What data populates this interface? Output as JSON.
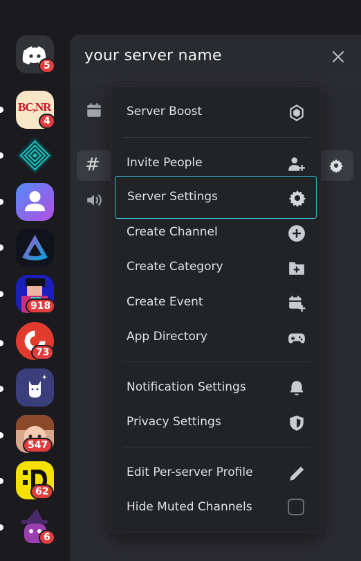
{
  "rail": {
    "servers": [
      {
        "name": "discord-home",
        "badge": "5"
      },
      {
        "name": "bcnr",
        "badge": "4",
        "text": "BC,NR"
      },
      {
        "name": "diamond-server",
        "badge": ""
      },
      {
        "name": "user-server",
        "badge": ""
      },
      {
        "name": "jellyfin-server",
        "badge": ""
      },
      {
        "name": "pixel-server",
        "badge": "918"
      },
      {
        "name": "red-server",
        "badge": "73"
      },
      {
        "name": "cat-server",
        "badge": ""
      },
      {
        "name": "anime-server",
        "badge": "547"
      },
      {
        "name": "yellow-server",
        "badge": "62"
      },
      {
        "name": "witch-server",
        "badge": "6"
      }
    ]
  },
  "panel": {
    "title": "your server name"
  },
  "menu": {
    "server_boost": "Server Boost",
    "invite_people": "Invite People",
    "server_settings": "Server Settings",
    "create_channel": "Create Channel",
    "create_category": "Create Category",
    "create_event": "Create Event",
    "app_directory": "App Directory",
    "notification_settings": "Notification Settings",
    "privacy_settings": "Privacy Settings",
    "edit_profile": "Edit Per-server Profile",
    "hide_muted": "Hide Muted Channels"
  },
  "colors": {
    "accent_outline": "#3ab9c9",
    "badge": "#e03e3e",
    "blurple": "#5865f2"
  }
}
